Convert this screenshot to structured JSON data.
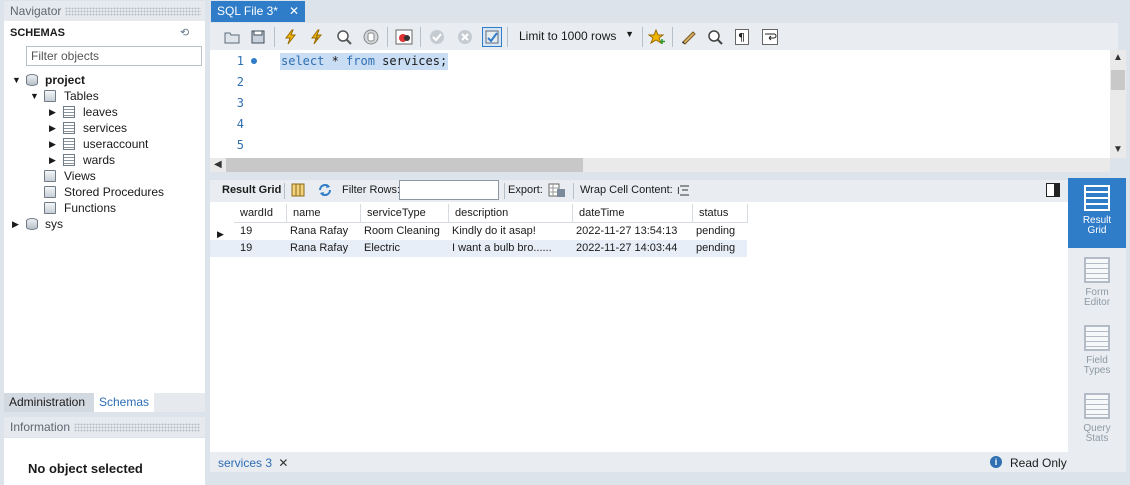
{
  "navigator": {
    "header": "Navigator",
    "schemas_title": "SCHEMAS",
    "filter_placeholder": "Filter objects",
    "tree": {
      "project": "project",
      "tables": "Tables",
      "table_items": [
        "leaves",
        "services",
        "useraccount",
        "wards"
      ],
      "views": "Views",
      "stored_procedures": "Stored Procedures",
      "functions": "Functions",
      "sys": "sys"
    },
    "bottom_tabs": {
      "administration": "Administration",
      "schemas": "Schemas"
    },
    "information_header": "Information",
    "no_object": "No object selected"
  },
  "editor": {
    "tab_label": "SQL File 3*",
    "limit_label": "Limit to 1000 rows",
    "line_numbers": [
      "1",
      "2",
      "3",
      "4",
      "5"
    ],
    "sql": {
      "kw1": "select",
      "mid": " * ",
      "kw2": "from",
      "rest": " services;"
    }
  },
  "result": {
    "toolbar": {
      "result_grid": "Result Grid",
      "filter_rows": "Filter Rows:",
      "export": "Export:",
      "wrap_cell": "Wrap Cell Content:"
    },
    "columns": [
      "wardId",
      "name",
      "serviceType",
      "description",
      "dateTime",
      "status"
    ],
    "rows": [
      [
        "19",
        "Rana Rafay",
        "Room Cleaning",
        "Kindly do it asap!",
        "2022-11-27 13:54:13",
        "pending"
      ],
      [
        "19",
        "Rana Rafay",
        "Electric",
        "I want a bulb bro......",
        "2022-11-27 14:03:44",
        "pending"
      ]
    ],
    "side_panel": {
      "result_grid": [
        "Result",
        "Grid"
      ],
      "form_editor": [
        "Form",
        "Editor"
      ],
      "field_types": [
        "Field",
        "Types"
      ],
      "query_stats": [
        "Query",
        "Stats"
      ]
    },
    "bottom_tab": "services 3",
    "read_only": "Read Only"
  },
  "colors": {
    "accent": "#2f7cc8",
    "selection": "#c9ddf4",
    "keyword": "#2f6fb2"
  }
}
